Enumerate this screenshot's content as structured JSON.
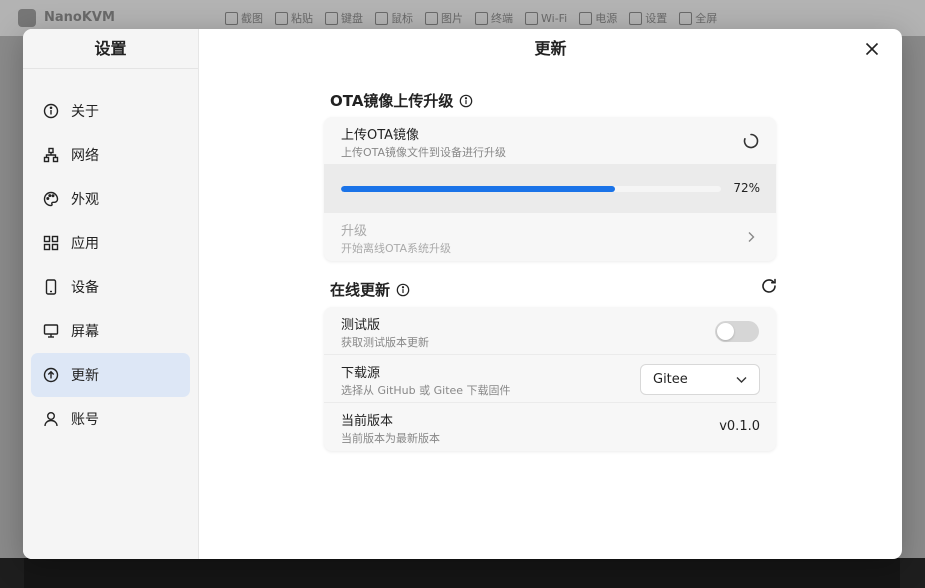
{
  "background": {
    "brand": "NanoKVM",
    "nav": [
      "截图",
      "粘贴",
      "键盘",
      "鼠标",
      "图片",
      "终端",
      "Wi-Fi",
      "电源",
      "设置",
      "全屏"
    ]
  },
  "sidebar": {
    "title": "设置",
    "items": [
      {
        "label": "关于",
        "icon": "info-icon"
      },
      {
        "label": "网络",
        "icon": "network-icon"
      },
      {
        "label": "外观",
        "icon": "palette-icon"
      },
      {
        "label": "应用",
        "icon": "apps-icon"
      },
      {
        "label": "设备",
        "icon": "device-icon"
      },
      {
        "label": "屏幕",
        "icon": "monitor-icon"
      },
      {
        "label": "更新",
        "icon": "update-icon",
        "active": true
      },
      {
        "label": "账号",
        "icon": "user-icon"
      }
    ]
  },
  "main": {
    "title": "更新",
    "ota": {
      "section_title": "OTA镜像上传升级",
      "upload": {
        "title": "上传OTA镜像",
        "subtitle": "上传OTA镜像文件到设备进行升级"
      },
      "progress": {
        "percent": 72,
        "label": "72%"
      },
      "upgrade": {
        "title": "升级",
        "subtitle": "开始离线OTA系统升级"
      }
    },
    "online": {
      "section_title": "在线更新",
      "beta": {
        "title": "测试版",
        "subtitle": "获取测试版本更新",
        "enabled": false
      },
      "source": {
        "title": "下载源",
        "subtitle": "选择从 GitHub 或 Gitee 下载固件",
        "selected": "Gitee"
      },
      "version": {
        "title": "当前版本",
        "subtitle": "当前版本为最新版本",
        "value": "v0.1.0"
      }
    }
  },
  "colors": {
    "accent": "#1a73e8",
    "active_bg": "#dde7f6"
  }
}
